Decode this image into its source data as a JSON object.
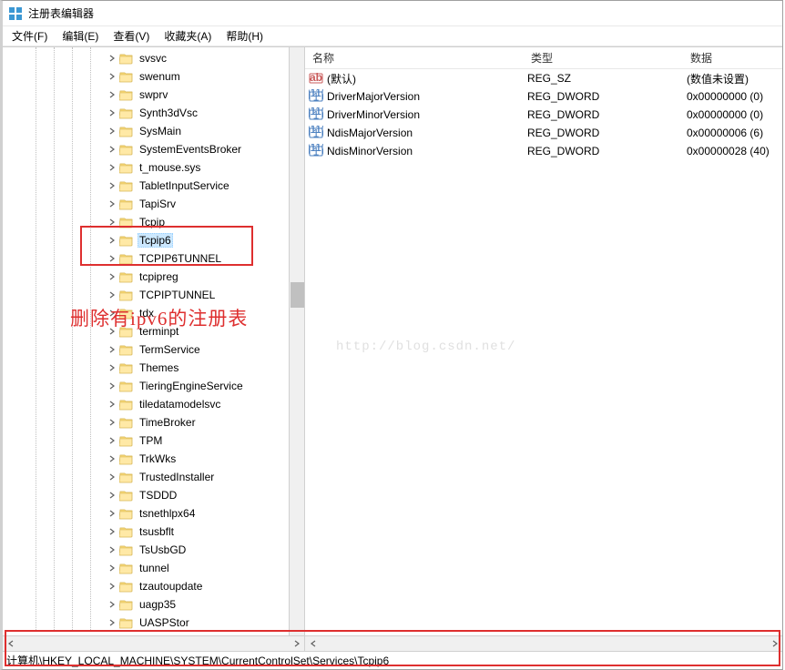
{
  "window": {
    "title": "注册表编辑器"
  },
  "menu": {
    "file": "文件(F)",
    "edit": "编辑(E)",
    "view": "查看(V)",
    "fav": "收藏夹(A)",
    "help": "帮助(H)"
  },
  "tree": {
    "items": [
      {
        "label": "svsvc"
      },
      {
        "label": "swenum"
      },
      {
        "label": "swprv"
      },
      {
        "label": "Synth3dVsc"
      },
      {
        "label": "SysMain"
      },
      {
        "label": "SystemEventsBroker"
      },
      {
        "label": "t_mouse.sys"
      },
      {
        "label": "TabletInputService"
      },
      {
        "label": "TapiSrv"
      },
      {
        "label": "Tcpip"
      },
      {
        "label": "Tcpip6",
        "selected": true
      },
      {
        "label": "TCPIP6TUNNEL"
      },
      {
        "label": "tcpipreg"
      },
      {
        "label": "TCPIPTUNNEL"
      },
      {
        "label": "tdx"
      },
      {
        "label": "terminpt"
      },
      {
        "label": "TermService"
      },
      {
        "label": "Themes"
      },
      {
        "label": "TieringEngineService"
      },
      {
        "label": "tiledatamodelsvc"
      },
      {
        "label": "TimeBroker"
      },
      {
        "label": "TPM"
      },
      {
        "label": "TrkWks"
      },
      {
        "label": "TrustedInstaller"
      },
      {
        "label": "TSDDD"
      },
      {
        "label": "tsnethlpx64"
      },
      {
        "label": "tsusbflt"
      },
      {
        "label": "TsUsbGD"
      },
      {
        "label": "tunnel"
      },
      {
        "label": "tzautoupdate"
      },
      {
        "label": "uagp35"
      },
      {
        "label": "UASPStor"
      }
    ]
  },
  "list": {
    "columns": {
      "name": "名称",
      "type": "类型",
      "data": "数据"
    },
    "rows": [
      {
        "iconType": "sz",
        "name": "(默认)",
        "type": "REG_SZ",
        "data": "(数值未设置)"
      },
      {
        "iconType": "dword",
        "name": "DriverMajorVersion",
        "type": "REG_DWORD",
        "data": "0x00000000 (0)"
      },
      {
        "iconType": "dword",
        "name": "DriverMinorVersion",
        "type": "REG_DWORD",
        "data": "0x00000000 (0)"
      },
      {
        "iconType": "dword",
        "name": "NdisMajorVersion",
        "type": "REG_DWORD",
        "data": "0x00000006 (6)"
      },
      {
        "iconType": "dword",
        "name": "NdisMinorVersion",
        "type": "REG_DWORD",
        "data": "0x00000028 (40)"
      }
    ]
  },
  "status": {
    "path": "计算机\\HKEY_LOCAL_MACHINE\\SYSTEM\\CurrentControlSet\\Services\\Tcpip6"
  },
  "annotation": {
    "text": "删除有ipv6的注册表",
    "watermark": "http://blog.csdn.net/"
  },
  "svg": {
    "folder": "<svg width='16' height='14' viewBox='0 0 16 14'><path d='M1 3 h5 l1 1 h7 v8 a1 1 0 0 1 -1 1 h-12 a1 1 0 0 1 -1 -1 z' fill='#ffe9a6' stroke='#d6b656' stroke-width='0.8'/><path d='M1 3 h5 l1 1 h7 v1 h-13 z' fill='#f7d774' stroke='#d6b656' stroke-width='0.5'/></svg>",
    "chevron": "<svg width='8' height='8' viewBox='0 0 8 8'><path d='M2 1 L6 4 L2 7' fill='none' stroke='#606060' stroke-width='1.2'/></svg>",
    "leftArrow": "<svg width='8' height='8' viewBox='0 0 8 8'><path d='M6 1 L2 4 L6 7' fill='none' stroke='#606060' stroke-width='1.2'/></svg>",
    "appIcon": "<svg width='16' height='16' viewBox='0 0 16 16'><rect x='1' y='1' width='6' height='6' fill='#3b97d3'/><rect x='9' y='1' width='6' height='6' fill='#3b97d3'/><rect x='1' y='9' width='6' height='6' fill='#3b97d3'/><rect x='9' y='9' width='6' height='6' fill='#3b97d3'/></svg>",
    "szIcon": "<svg width='16' height='16' viewBox='0 0 16 16'><rect x='1' y='3' width='14' height='10' rx='1' fill='#fff' stroke='#c95b5b'/><text x='8' y='11' text-anchor='middle' font-size='7' font-family='Arial' fill='#c95b5b' font-weight='bold'>ab</text></svg>",
    "dwordIcon": "<svg width='16' height='16' viewBox='0 0 16 16'><rect x='1' y='3' width='14' height='10' rx='1' fill='#fff' stroke='#4a7fbf'/><text x='4.5' y='8' text-anchor='middle' font-size='4.5' fill='#4a7fbf'>011</text><text x='11' y='8' text-anchor='middle' font-size='4.5' fill='#4a7fbf'>110</text><text x='8' y='12.5' text-anchor='middle' font-size='4.5' fill='#4a7fbf'>0 1 0</text></svg>"
  }
}
